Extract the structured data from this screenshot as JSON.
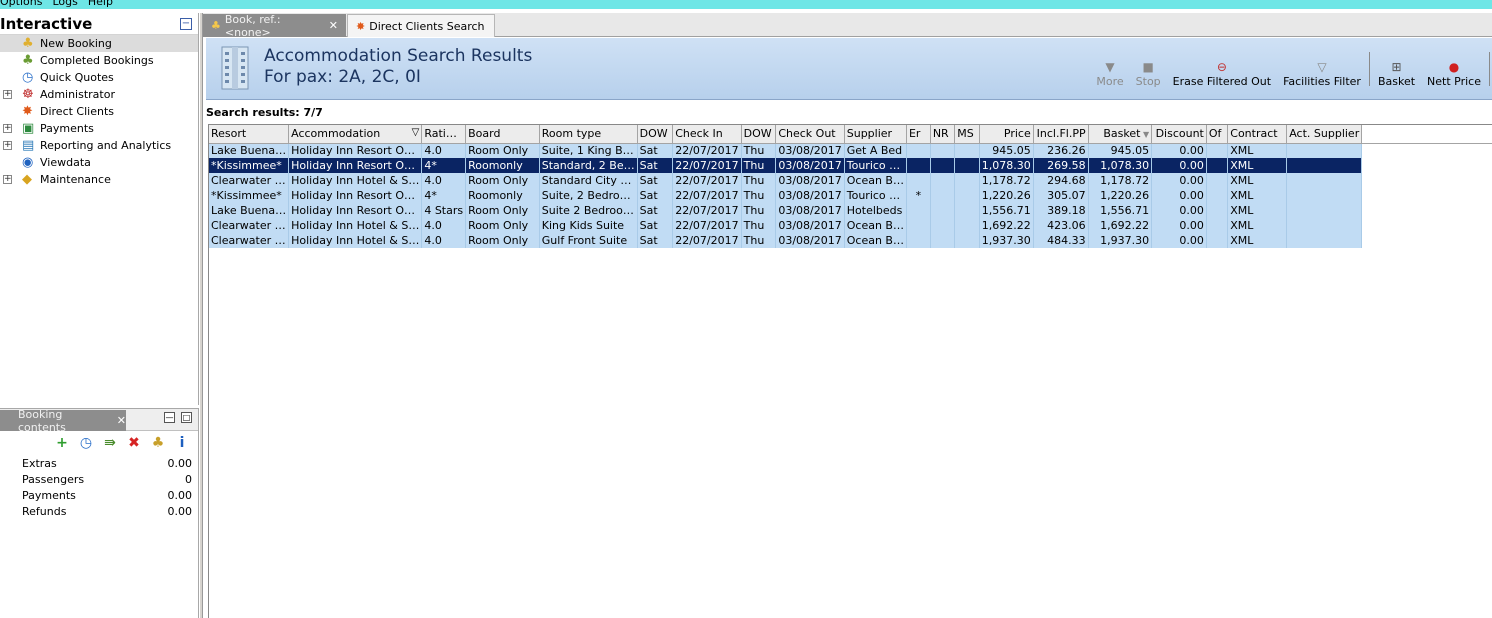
{
  "menu": [
    "Options",
    "Logs",
    "Help"
  ],
  "nav": {
    "title": "Interactive",
    "collapse_label": "−",
    "items": [
      {
        "label": "New Booking",
        "expandable": false,
        "selected": true
      },
      {
        "label": "Completed Bookings",
        "expandable": false
      },
      {
        "label": "Quick Quotes",
        "expandable": false
      },
      {
        "label": "Administrator",
        "expandable": true
      },
      {
        "label": "Direct Clients",
        "expandable": false
      },
      {
        "label": "Payments",
        "expandable": true
      },
      {
        "label": "Reporting and Analytics",
        "expandable": true
      },
      {
        "label": "Viewdata",
        "expandable": false
      },
      {
        "label": "Maintenance",
        "expandable": true
      }
    ]
  },
  "booking": {
    "tab_label": "Booking contents",
    "rows": [
      {
        "label": "Extras",
        "value": "0.00"
      },
      {
        "label": "Passengers",
        "value": "0"
      },
      {
        "label": "Payments",
        "value": "0.00"
      },
      {
        "label": "Refunds",
        "value": "0.00"
      }
    ]
  },
  "tabs": {
    "active": "Book, ref.: <none>",
    "inactive": "Direct Clients Search"
  },
  "header": {
    "title": "Accommodation Search Results",
    "subtitle": "For pax: 2A, 2C, 0I"
  },
  "toolbar": {
    "more": "More",
    "stop": "Stop",
    "erase": "Erase Filtered Out",
    "facilities": "Facilities Filter",
    "basket": "Basket",
    "nett": "Nett Price"
  },
  "results_label": "Search results: 7/7",
  "grid": {
    "columns": [
      "Resort",
      "Accommodation",
      "Rati…",
      "Board",
      "Room type",
      "DOW",
      "Check In",
      "DOW",
      "Check Out",
      "Supplier",
      "Er",
      "NR",
      "MS",
      "Price",
      "Incl.Fl.PP",
      "Basket",
      "Discount",
      "Of",
      "Contract",
      "Act. Supplier"
    ],
    "rows": [
      [
        "Lake Buena…",
        "Holiday Inn Resort O…",
        "4.0",
        "Room Only",
        "Suite, 1 King B…",
        "Sat",
        "22/07/2017",
        "Thu",
        "03/08/2017",
        "Get A Bed",
        "",
        "",
        "",
        "945.05",
        "236.26",
        "945.05",
        "0.00",
        "",
        "XML",
        ""
      ],
      [
        "*Kissimmee*",
        "Holiday Inn Resort O…",
        "4*",
        "Roomonly",
        "Standard, 2 Be…",
        "Sat",
        "22/07/2017",
        "Thu",
        "03/08/2017",
        "Tourico …",
        "",
        "",
        "",
        "1,078.30",
        "269.58",
        "1,078.30",
        "0.00",
        "",
        "XML",
        ""
      ],
      [
        "Clearwater …",
        "Holiday Inn Hotel & S…",
        "4.0",
        "Room Only",
        "Standard City …",
        "Sat",
        "22/07/2017",
        "Thu",
        "03/08/2017",
        "Ocean B…",
        "",
        "",
        "",
        "1,178.72",
        "294.68",
        "1,178.72",
        "0.00",
        "",
        "XML",
        ""
      ],
      [
        "*Kissimmee*",
        "Holiday Inn Resort O…",
        "4*",
        "Roomonly",
        "Suite, 2 Bedro…",
        "Sat",
        "22/07/2017",
        "Thu",
        "03/08/2017",
        "Tourico …",
        "*",
        "",
        "",
        "1,220.26",
        "305.07",
        "1,220.26",
        "0.00",
        "",
        "XML",
        ""
      ],
      [
        "Lake Buena…",
        "Holiday Inn Resort O…",
        "4 Stars",
        "Room Only",
        "Suite 2 Bedroo…",
        "Sat",
        "22/07/2017",
        "Thu",
        "03/08/2017",
        "Hotelbeds",
        "",
        "",
        "",
        "1,556.71",
        "389.18",
        "1,556.71",
        "0.00",
        "",
        "XML",
        ""
      ],
      [
        "Clearwater …",
        "Holiday Inn Hotel & S…",
        "4.0",
        "Room Only",
        "King Kids Suite",
        "Sat",
        "22/07/2017",
        "Thu",
        "03/08/2017",
        "Ocean B…",
        "",
        "",
        "",
        "1,692.22",
        "423.06",
        "1,692.22",
        "0.00",
        "",
        "XML",
        ""
      ],
      [
        "Clearwater …",
        "Holiday Inn Hotel & S…",
        "4.0",
        "Room Only",
        "Gulf Front Suite",
        "Sat",
        "22/07/2017",
        "Thu",
        "03/08/2017",
        "Ocean B…",
        "",
        "",
        "",
        "1,937.30",
        "484.33",
        "1,937.30",
        "0.00",
        "",
        "XML",
        ""
      ]
    ],
    "selected_row": 1
  },
  "colors": {
    "selected_row": "#0a2463",
    "row_bg": "#c1dcf4",
    "header_bg": "#b7d0ec"
  }
}
